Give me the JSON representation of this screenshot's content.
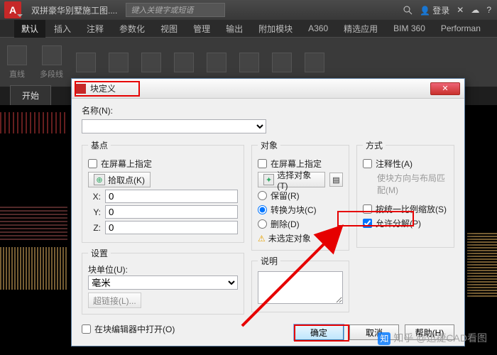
{
  "titlebar": {
    "doc_title": "双拼豪华别墅施工图....",
    "search_placeholder": "键入关键字或短语",
    "login": "登录"
  },
  "menu": {
    "items": [
      "默认",
      "插入",
      "注释",
      "参数化",
      "视图",
      "管理",
      "输出",
      "附加模块",
      "A360",
      "精选应用",
      "BIM 360",
      "Performan"
    ]
  },
  "ribbon": {
    "items": [
      "直线",
      "多段线",
      "",
      "",
      "",
      "",
      "",
      "",
      "",
      ""
    ]
  },
  "draw_tab": "开始",
  "dialog": {
    "title": "块定义",
    "name_label": "名称(N):",
    "base": {
      "legend": "基点",
      "on_screen": "在屏幕上指定",
      "pick_point": "拾取点(K)",
      "x_label": "X:",
      "x": "0",
      "y_label": "Y:",
      "y": "0",
      "z_label": "Z:",
      "z": "0"
    },
    "object": {
      "legend": "对象",
      "on_screen": "在屏幕上指定",
      "select": "选择对象(T)",
      "retain": "保留(R)",
      "convert": "转换为块(C)",
      "delete": "删除(D)",
      "none": "未选定对象"
    },
    "mode": {
      "legend": "方式",
      "annotative": "注释性(A)",
      "match_orient": "使块方向与布局匹配(M)",
      "uniform": "按统一比例缩放(S)",
      "explode": "允许分解(P)"
    },
    "settings": {
      "legend": "设置",
      "unit_label": "块单位(U):",
      "unit_value": "毫米",
      "hyperlink": "超链接(L)..."
    },
    "description": {
      "legend": "说明"
    },
    "open_editor": "在块编辑器中打开(O)",
    "ok": "确定",
    "cancel": "取消",
    "help": "帮助(H)"
  },
  "watermark": "知乎 @迅捷CAD看图"
}
